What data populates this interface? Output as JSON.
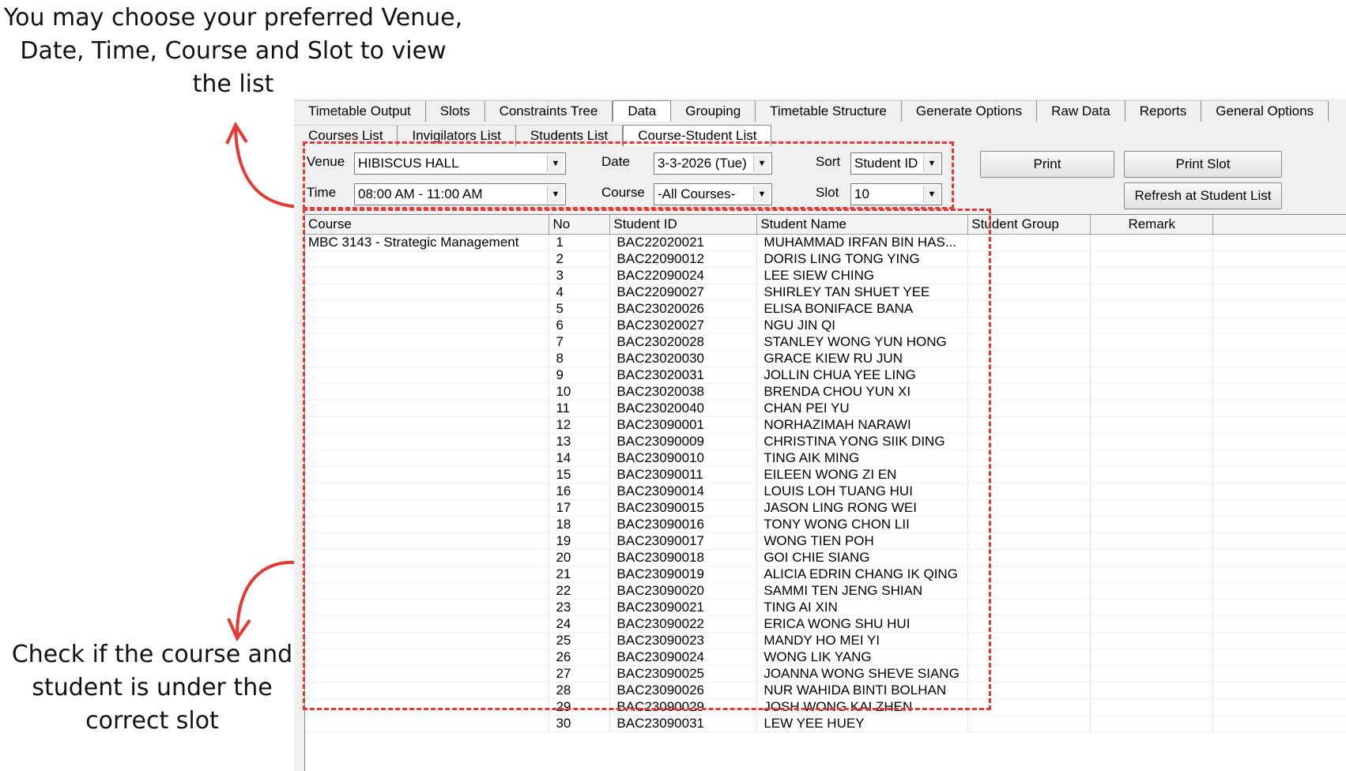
{
  "annotations": {
    "top": "You may choose your preferred Venue, Date, Time, Course and Slot to view the list",
    "bottom": "Check if the course and student is under the correct slot"
  },
  "colors": {
    "highlight": "#e53935",
    "arrow": "#e53935"
  },
  "tabs_main": [
    "Timetable Output",
    "Slots",
    "Constraints Tree",
    "Data",
    "Grouping",
    "Timetable Structure",
    "Generate Options",
    "Raw Data",
    "Reports",
    "General Options"
  ],
  "tabs_main_active": "Data",
  "tabs_sub": [
    "Courses List",
    "Invigilators List",
    "Students List",
    "Course-Student List"
  ],
  "tabs_sub_active": "Course-Student List",
  "filters": {
    "venue_label": "Venue",
    "venue_value": "HIBISCUS HALL",
    "date_label": "Date",
    "date_value": "3-3-2026 (Tue)",
    "sort_label": "Sort",
    "sort_value": "Student ID",
    "time_label": "Time",
    "time_value": "08:00 AM - 11:00 AM",
    "course_label": "Course",
    "course_value": "-All Courses-",
    "slot_label": "Slot",
    "slot_value": "10"
  },
  "buttons": {
    "print": "Print",
    "print_slot": "Print Slot",
    "refresh": "Refresh at Student List"
  },
  "table": {
    "columns": [
      "Course",
      "No",
      "Student ID",
      "Student Name",
      "Student Group",
      "Remark"
    ],
    "course": "MBC 3143 - Strategic Management",
    "rows": [
      [
        "1",
        "BAC22020021",
        "MUHAMMAD IRFAN BIN HAS..."
      ],
      [
        "2",
        "BAC22090012",
        "DORIS LING TONG YING"
      ],
      [
        "3",
        "BAC22090024",
        "LEE SIEW CHING"
      ],
      [
        "4",
        "BAC22090027",
        "SHIRLEY TAN SHUET YEE"
      ],
      [
        "5",
        "BAC23020026",
        "ELISA BONIFACE BANA"
      ],
      [
        "6",
        "BAC23020027",
        "NGU JIN QI"
      ],
      [
        "7",
        "BAC23020028",
        "STANLEY WONG YUN HONG"
      ],
      [
        "8",
        "BAC23020030",
        "GRACE KIEW RU JUN"
      ],
      [
        "9",
        "BAC23020031",
        "JOLLIN CHUA YEE LING"
      ],
      [
        "10",
        "BAC23020038",
        "BRENDA CHOU YUN XI"
      ],
      [
        "11",
        "BAC23020040",
        "CHAN PEI YU"
      ],
      [
        "12",
        "BAC23090001",
        "NORHAZIMAH NARAWI"
      ],
      [
        "13",
        "BAC23090009",
        "CHRISTINA YONG SIIK DING"
      ],
      [
        "14",
        "BAC23090010",
        "TING AIK MING"
      ],
      [
        "15",
        "BAC23090011",
        "EILEEN WONG ZI EN"
      ],
      [
        "16",
        "BAC23090014",
        "LOUIS LOH TUANG HUI"
      ],
      [
        "17",
        "BAC23090015",
        "JASON LING RONG WEI"
      ],
      [
        "18",
        "BAC23090016",
        "TONY WONG CHON LII"
      ],
      [
        "19",
        "BAC23090017",
        "WONG TIEN POH"
      ],
      [
        "20",
        "BAC23090018",
        "GOI CHIE SIANG"
      ],
      [
        "21",
        "BAC23090019",
        "ALICIA EDRIN CHANG IK QING"
      ],
      [
        "22",
        "BAC23090020",
        "SAMMI TEN JENG SHIAN"
      ],
      [
        "23",
        "BAC23090021",
        "TING AI XIN"
      ],
      [
        "24",
        "BAC23090022",
        "ERICA WONG SHU HUI"
      ],
      [
        "25",
        "BAC23090023",
        "MANDY HO MEI YI"
      ],
      [
        "26",
        "BAC23090024",
        "WONG LIK YANG"
      ],
      [
        "27",
        "BAC23090025",
        "JOANNA WONG SHEVE SIANG"
      ],
      [
        "28",
        "BAC23090026",
        "NUR WAHIDA BINTI BOLHAN"
      ],
      [
        "29",
        "BAC23090029",
        "JOSH WONG KAI ZHEN"
      ],
      [
        "30",
        "BAC23090031",
        "LEW YEE HUEY"
      ]
    ]
  }
}
